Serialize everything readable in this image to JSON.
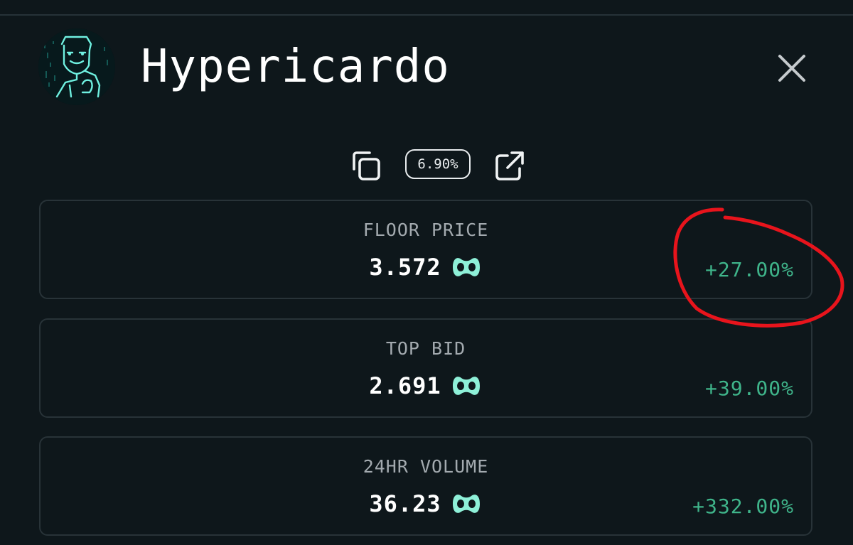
{
  "collection": {
    "title": "Hypericardo",
    "royalty_badge": "6.90%"
  },
  "icons": {
    "avatar": "collection-avatar",
    "close": "close-icon",
    "copy": "copy-icon",
    "external": "external-link-icon",
    "currency": "hype-token-icon"
  },
  "stats": [
    {
      "label": "FLOOR PRICE",
      "value": "3.572",
      "change": "+27.00%"
    },
    {
      "label": "TOP BID",
      "value": "2.691",
      "change": "+39.00%"
    },
    {
      "label": "24HR VOLUME",
      "value": "36.23",
      "change": "+332.00%"
    }
  ],
  "colors": {
    "background": "#0e171b",
    "card_border": "#283338",
    "label": "#a3aaaf",
    "positive_change": "#3fb48a",
    "token_accent": "#8ef0d8",
    "annotation": "#e8141c"
  }
}
